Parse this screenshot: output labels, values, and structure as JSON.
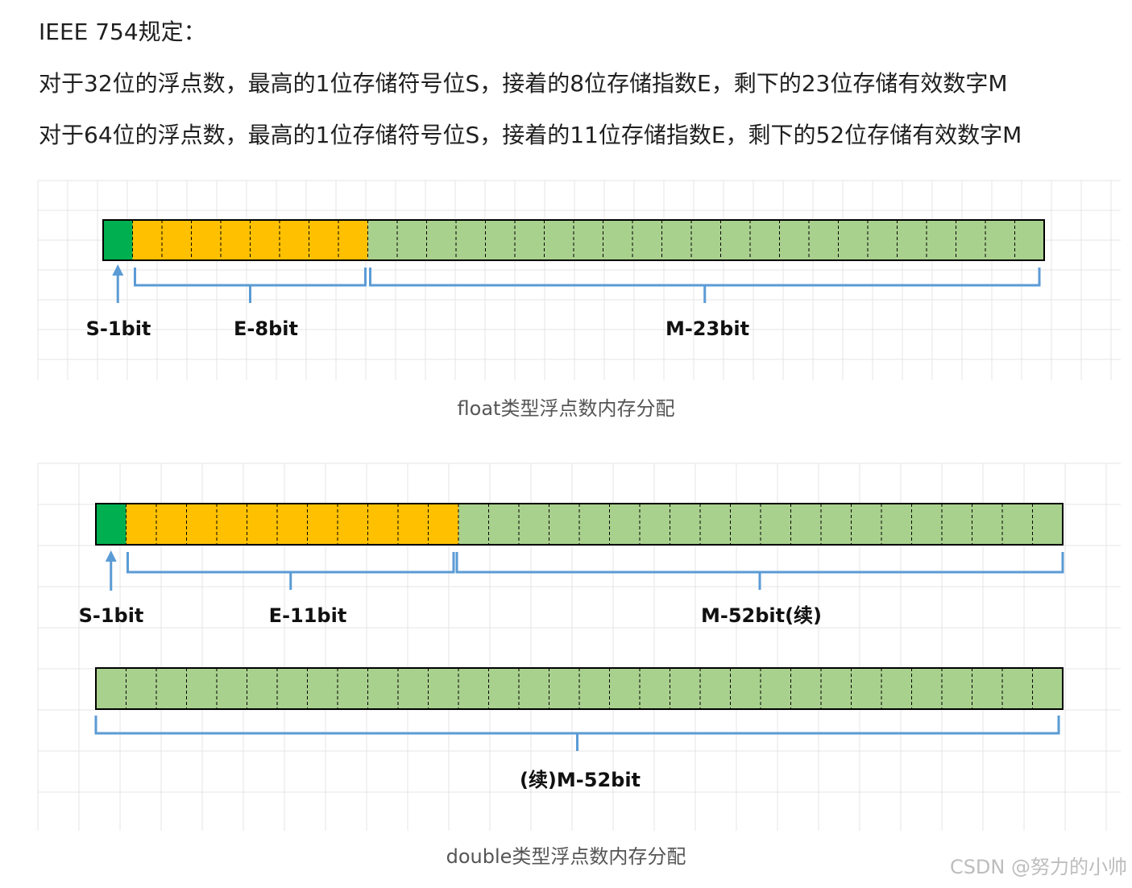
{
  "intro": {
    "title": "IEEE 754规定：",
    "line_32": "对于32位的浮点数，最高的1位存储符号位S，接着的8位存储指数E，剩下的23位存储有效数字M",
    "line_64": "对于64位的浮点数，最高的1位存储符号位S，接着的11位存储指数E，剩下的52位存储有效数字M"
  },
  "float_diagram": {
    "sign_label": "S-1bit",
    "exponent_label": "E-8bit",
    "mantissa_label": "M-23bit",
    "caption": "float类型浮点数内存分配",
    "sign_bits": 1,
    "exponent_bits": 8,
    "mantissa_bits": 23
  },
  "double_diagram": {
    "sign_label": "S-1bit",
    "exponent_label": "E-11bit",
    "mantissa_label": "M-52bit(续)",
    "continuation_label": "(续)M-52bit",
    "caption": "double类型浮点数内存分配",
    "sign_bits": 1,
    "exponent_bits": 11,
    "mantissa_bits_row1": 20,
    "mantissa_bits_row2": 32
  },
  "colors": {
    "sign": "#00b050",
    "exponent": "#ffc000",
    "mantissa": "#a9d18e",
    "bracket": "#5b9bd5",
    "grid": "#e4e4e4"
  },
  "watermark": "CSDN @努力的小帅"
}
